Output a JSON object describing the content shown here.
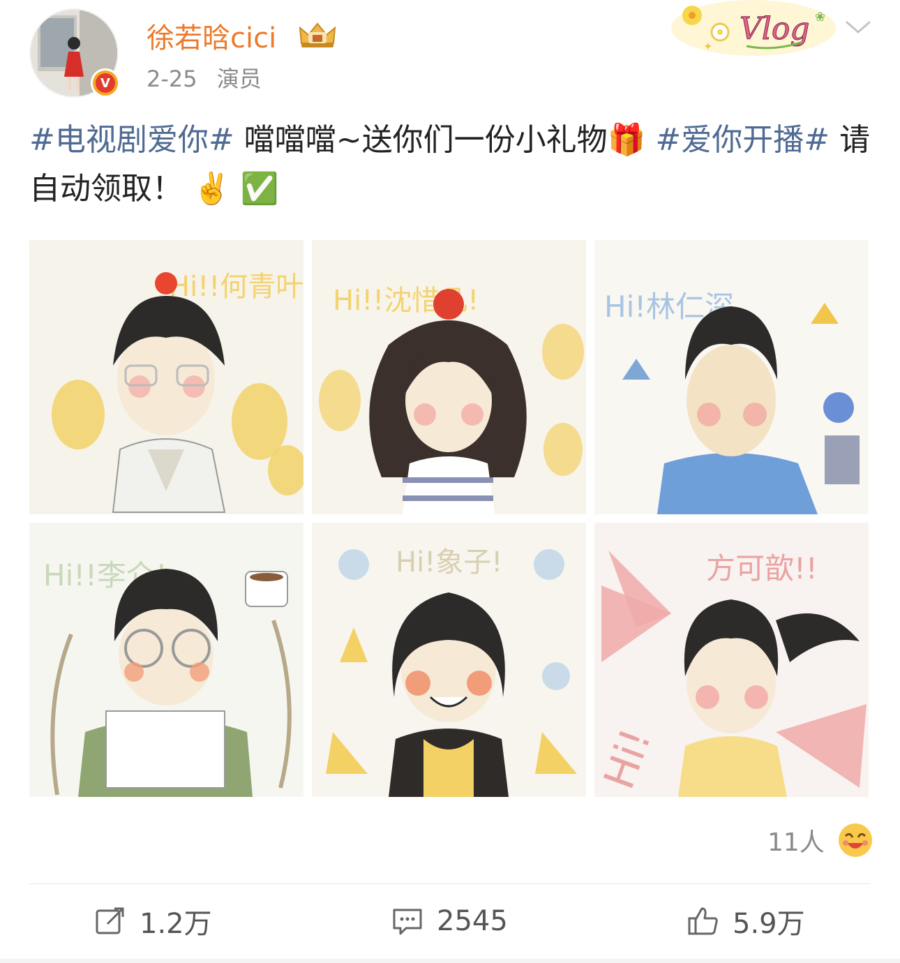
{
  "post": {
    "author": {
      "name": "徐若晗cici",
      "verified": true
    },
    "date": "2-25",
    "role": "演员",
    "content": {
      "topic1": "#电视剧爱你#",
      "text1": " 噹噹噹~送你们一份小礼物",
      "emoji_gift": "🎁",
      "topic2": "#爱你开播#",
      "text2": " 请自动领取！",
      "emoji_peace": "✌️",
      "emoji_check": "✅"
    },
    "images": [
      {
        "label": "Hi!!何青叶!!",
        "bg": "#f6f3ea",
        "accent": "#f2c54b"
      },
      {
        "label": "Hi!!沈惜凡!",
        "bg": "#f7f4ec",
        "accent": "#f0c94f"
      },
      {
        "label": "Hi!林仁深",
        "bg": "#f8f7f2",
        "accent": "#7fa7d6"
      },
      {
        "label": "Hi!!李介!",
        "bg": "#f6f6f1",
        "accent": "#8cb8d6"
      },
      {
        "label": "Hi!象子!",
        "bg": "#f7f5ee",
        "accent": "#f3d165"
      },
      {
        "label": "方可歆!!",
        "bg": "#f8f3f0",
        "accent": "#f0a9a9"
      }
    ],
    "reactions": {
      "count_text": "11人"
    },
    "actions": {
      "repost": "1.2万",
      "comment": "2545",
      "like": "5.9万"
    }
  },
  "colors": {
    "username": "#ed7a2c",
    "topic": "#4f6a93",
    "meta": "#8a8a8a"
  }
}
